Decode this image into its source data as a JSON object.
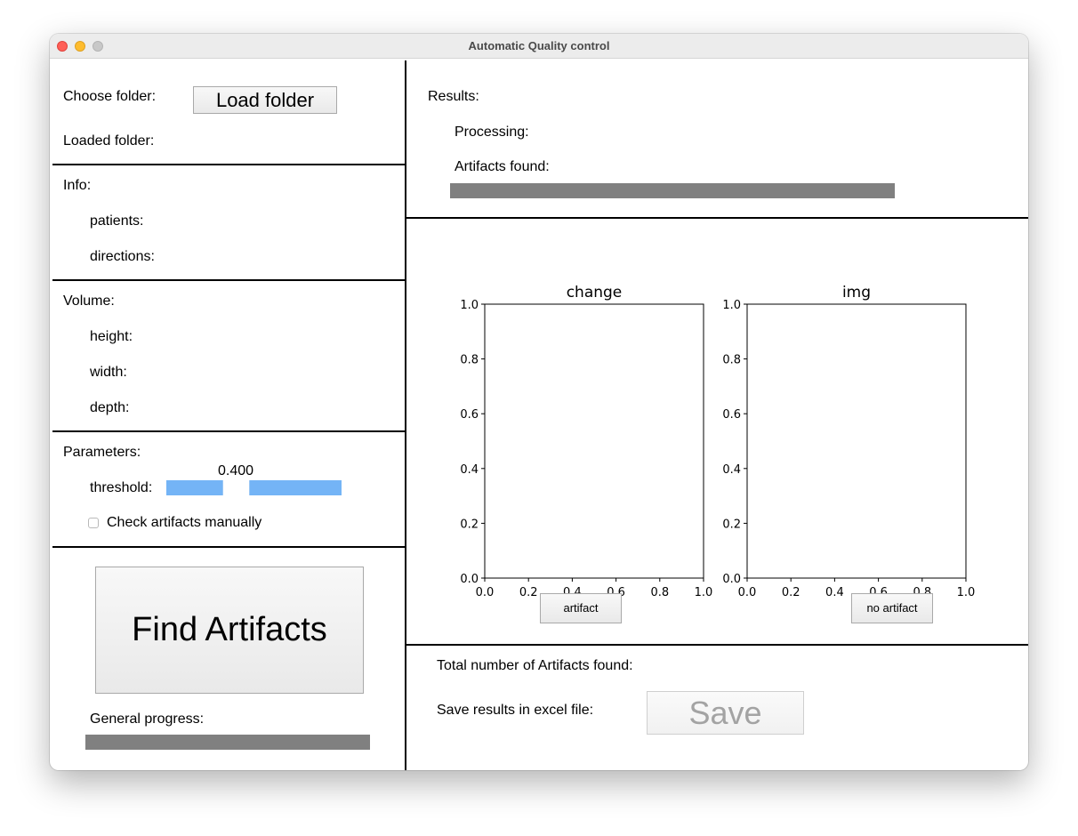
{
  "window": {
    "title": "Automatic Quality control"
  },
  "folder": {
    "choose_label": "Choose folder:",
    "load_button": "Load folder",
    "loaded_label": "Loaded folder:"
  },
  "info": {
    "header": "Info:",
    "patients_label": "patients:",
    "directions_label": "directions:"
  },
  "volume": {
    "header": "Volume:",
    "height_label": "height:",
    "width_label": "width:",
    "depth_label": "depth:"
  },
  "parameters": {
    "header": "Parameters:",
    "threshold_label": "threshold:",
    "threshold_value": "0.400",
    "threshold_fraction": 0.4,
    "check_manual_label": "Check  artifacts manually",
    "check_manual_checked": false
  },
  "actions": {
    "find_button": "Find Artifacts",
    "general_progress_label": "General progress:",
    "general_progress": 1.0
  },
  "results": {
    "header": "Results:",
    "processing_label": "Processing:",
    "artifacts_found_label": "Artifacts found:",
    "artifacts_progress": 1.0
  },
  "chart_data": [
    {
      "type": "scatter",
      "title": "change",
      "xlabel": "",
      "ylabel": "",
      "xlim": [
        0,
        1
      ],
      "ylim": [
        0,
        1
      ],
      "xticks": [
        "0.0",
        "0.2",
        "0.4",
        "0.6",
        "0.8",
        "1.0"
      ],
      "yticks": [
        "0.0",
        "0.2",
        "0.4",
        "0.6",
        "0.8",
        "1.0"
      ],
      "series": [],
      "grid": false
    },
    {
      "type": "scatter",
      "title": "img",
      "xlabel": "",
      "ylabel": "",
      "xlim": [
        0,
        1
      ],
      "ylim": [
        0,
        1
      ],
      "xticks": [
        "0.0",
        "0.2",
        "0.4",
        "0.6",
        "0.8",
        "1.0"
      ],
      "yticks": [
        "0.0",
        "0.2",
        "0.4",
        "0.6",
        "0.8",
        "1.0"
      ],
      "series": [],
      "grid": false
    }
  ],
  "review": {
    "artifact_button": "artifact",
    "no_artifact_button": "no artifact"
  },
  "summary": {
    "total_label": "Total number of Artifacts found:",
    "save_label": "Save results in excel file:",
    "save_button": "Save",
    "save_disabled_color": "#a3a3a3"
  }
}
